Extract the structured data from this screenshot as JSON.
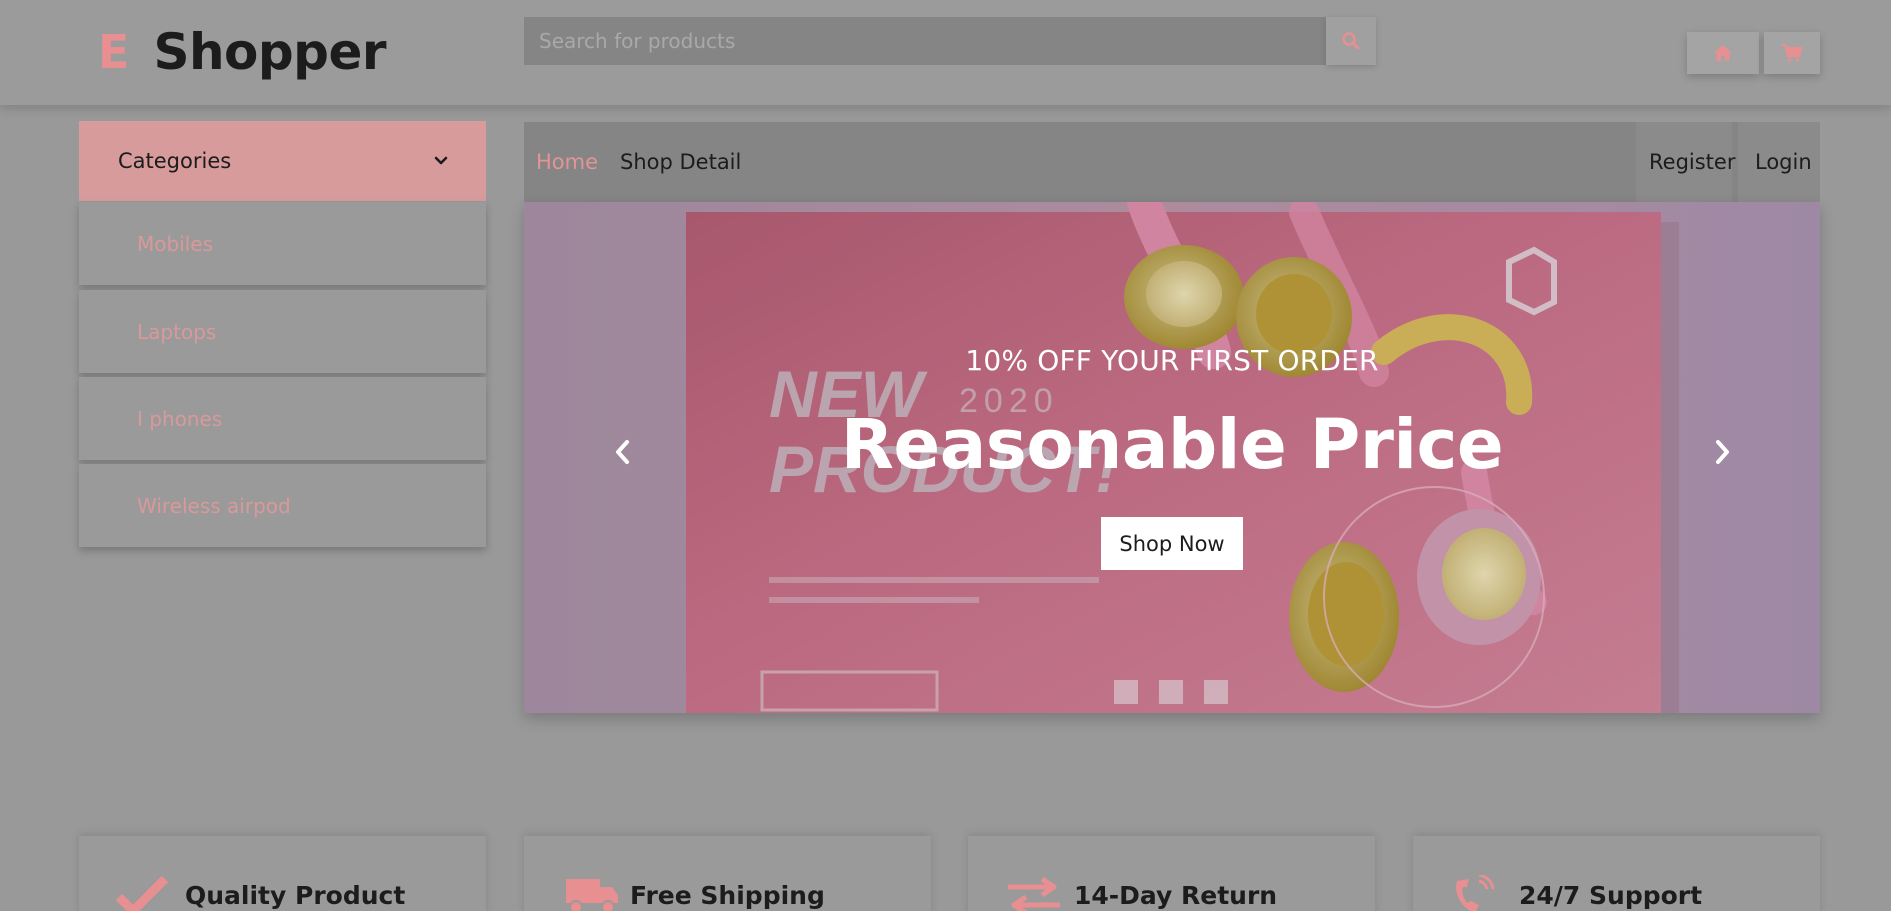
{
  "header": {
    "logo_letter": "E",
    "logo_text": "Shopper",
    "search_placeholder": "Search for products",
    "search_icon": "search-icon",
    "home_icon": "home-icon",
    "cart_icon": "cart-icon"
  },
  "sidebar": {
    "categories_label": "Categories",
    "categories_icon": "chevron-down-icon",
    "items": [
      {
        "label": "Mobiles"
      },
      {
        "label": "Laptops"
      },
      {
        "label": "I phones"
      },
      {
        "label": "Wireless airpod"
      }
    ]
  },
  "nav": {
    "left": [
      {
        "label": "Home",
        "active": true
      },
      {
        "label": "Shop Detail",
        "active": false
      }
    ],
    "right": [
      {
        "label": "Register"
      },
      {
        "label": "Login"
      }
    ]
  },
  "carousel": {
    "subtitle": "10% OFF YOUR FIRST ORDER",
    "title": "Reasonable Price",
    "button_label": "Shop Now",
    "prev_icon": "chevron-left-icon",
    "next_icon": "chevron-right-icon"
  },
  "features": [
    {
      "title": "Quality Product",
      "icon": "check-icon"
    },
    {
      "title": "Free Shipping",
      "icon": "truck-icon"
    },
    {
      "title": "14-Day Return",
      "icon": "exchange-icon"
    },
    {
      "title": "24/7 Support",
      "icon": "phone-icon"
    }
  ],
  "colors": {
    "accent": "#e88f92",
    "page_bg": "#999999",
    "navbar_bg": "#858585",
    "categories_bg": "#d79b9c"
  }
}
